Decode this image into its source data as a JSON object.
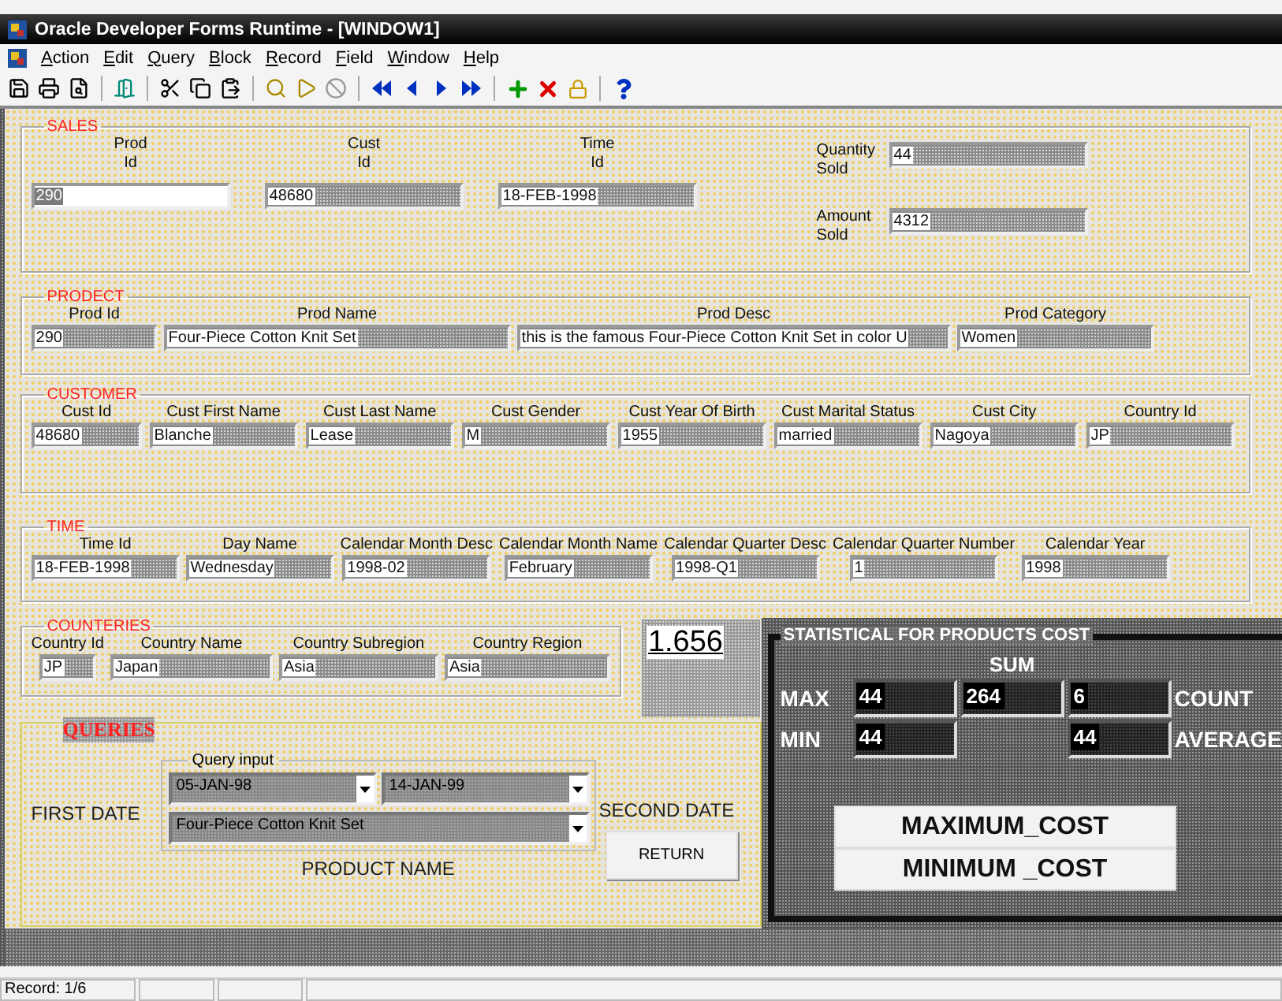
{
  "window": {
    "title": "Oracle Developer Forms Runtime - [WINDOW1]"
  },
  "menu": [
    "Action",
    "Edit",
    "Query",
    "Block",
    "Record",
    "Field",
    "Window",
    "Help"
  ],
  "sales": {
    "title": "SALES",
    "fields": [
      {
        "label": "Prod Id",
        "value": "290",
        "kind": "stacked",
        "focused": true
      },
      {
        "label": "Cust Id",
        "value": "48680",
        "kind": "stacked",
        "focused": false
      },
      {
        "label": "Time Id",
        "value": "18-FEB-1998",
        "kind": "stacked",
        "focused": false
      },
      {
        "label": "Quantity Sold",
        "value": "44",
        "kind": "inline",
        "focused": false
      },
      {
        "label": "Amount Sold",
        "value": "4312",
        "kind": "inline",
        "focused": false
      }
    ]
  },
  "product": {
    "title": "PRODECT",
    "fields": [
      {
        "label": "Prod Id",
        "value": "290"
      },
      {
        "label": "Prod Name",
        "value": "Four-Piece Cotton Knit Set"
      },
      {
        "label": "Prod Desc",
        "value": "this is the famous Four-Piece Cotton Knit Set in color U"
      },
      {
        "label": "Prod Category",
        "value": "Women"
      }
    ]
  },
  "customer": {
    "title": "CUSTOMER",
    "fields": [
      {
        "label": "Cust Id",
        "value": "48680"
      },
      {
        "label": "Cust First Name",
        "value": "Blanche"
      },
      {
        "label": "Cust Last Name",
        "value": "Lease"
      },
      {
        "label": "Cust Gender",
        "value": "M"
      },
      {
        "label": "Cust Year Of Birth",
        "value": "1955"
      },
      {
        "label": "Cust Marital Status",
        "value": "married"
      },
      {
        "label": "Cust City",
        "value": "Nagoya"
      },
      {
        "label": "Country Id",
        "value": "JP"
      }
    ]
  },
  "time": {
    "title": "TIME",
    "fields": [
      {
        "label": "Time Id",
        "value": "18-FEB-1998"
      },
      {
        "label": "Day Name",
        "value": "Wednesday"
      },
      {
        "label": "Calendar Month Desc",
        "value": "1998-02"
      },
      {
        "label": "Calendar Month Name",
        "value": "February"
      },
      {
        "label": "Calendar Quarter Desc",
        "value": "1998-Q1"
      },
      {
        "label": "Calendar Quarter Number",
        "value": "1"
      },
      {
        "label": "Calendar Year",
        "value": "1998"
      }
    ]
  },
  "countries": {
    "title": "COUNTERIES",
    "fields": [
      {
        "label": "Country Id",
        "value": "JP"
      },
      {
        "label": "Country Name",
        "value": "Japan"
      },
      {
        "label": "Country Subregion",
        "value": "Asia"
      },
      {
        "label": "Country Region",
        "value": "Asia"
      }
    ]
  },
  "ratio_display": "1.656",
  "queries": {
    "title": "QUERIES",
    "group_title": "Query input",
    "first_date_label": "FIRST DATE",
    "first_date": "05-JAN-98",
    "second_date": "14-JAN-99",
    "second_date_label": "SECOND DATE",
    "product": "Four-Piece Cotton Knit Set",
    "product_label": "PRODUCT NAME",
    "return_button": "RETURN"
  },
  "statistics": {
    "title": "STATISTICAL FOR PRODUCTS  COST",
    "column_header": "SUM",
    "rows": [
      {
        "label": "MAX",
        "cells": [
          {
            "kind": "field",
            "value": "44"
          },
          {
            "kind": "field",
            "value": "264"
          },
          {
            "kind": "field",
            "value": "6"
          }
        ],
        "trailing_label": "COUNT"
      },
      {
        "label": "MIN",
        "cells": [
          {
            "kind": "field",
            "value": "44"
          },
          {
            "kind": "blank"
          },
          {
            "kind": "field",
            "value": "44"
          }
        ],
        "trailing_label": "AVERAGE"
      }
    ],
    "buttons": [
      "MAXIMUM_COST",
      "MINIMUM _COST"
    ]
  },
  "status_bar": {
    "record": "Record: 1/6"
  }
}
